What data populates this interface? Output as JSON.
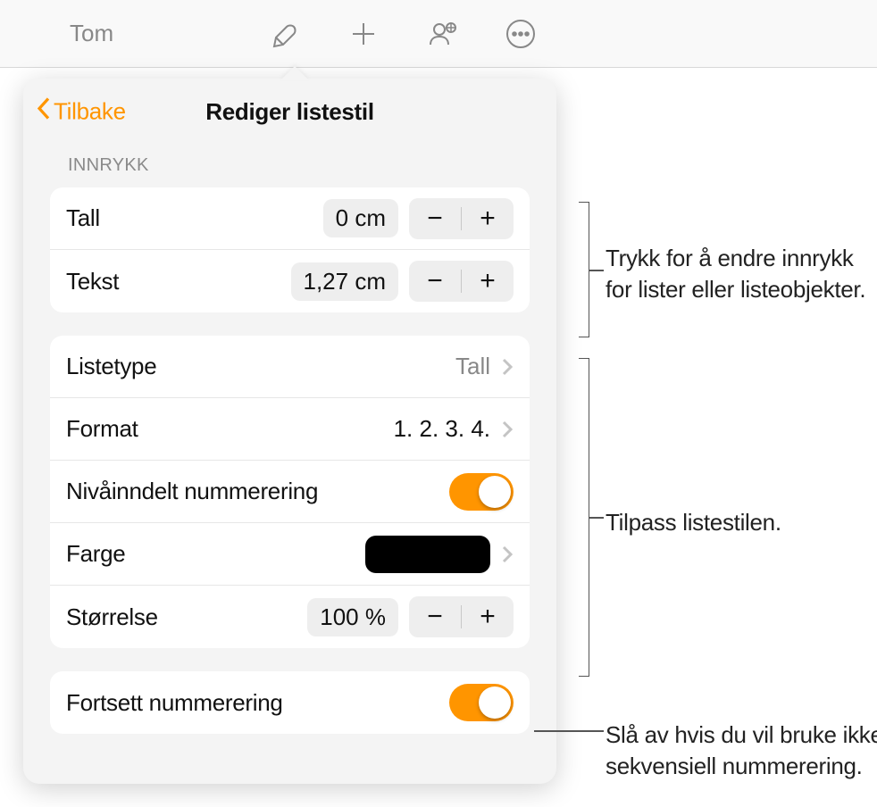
{
  "toolbar": {
    "doc_title": "Tom"
  },
  "popover": {
    "back_label": "Tilbake",
    "title": "Rediger listestil",
    "section_indent": "INNRYKK",
    "indent": {
      "number_label": "Tall",
      "number_value": "0 cm",
      "text_label": "Tekst",
      "text_value": "1,27 cm"
    },
    "style": {
      "listtype_label": "Listetype",
      "listtype_value": "Tall",
      "format_label": "Format",
      "format_value": "1. 2. 3. 4.",
      "tiered_label": "Nivåinndelt nummerering",
      "color_label": "Farge",
      "size_label": "Størrelse",
      "size_value": "100 %"
    },
    "continue": {
      "label": "Fortsett nummerering"
    }
  },
  "callouts": {
    "c1": "Trykk for å endre innrykk for lister eller listeobjekter.",
    "c2": "Tilpass listestilen.",
    "c3": "Slå av hvis du vil bruke ikke-sekvensiell nummerering."
  }
}
